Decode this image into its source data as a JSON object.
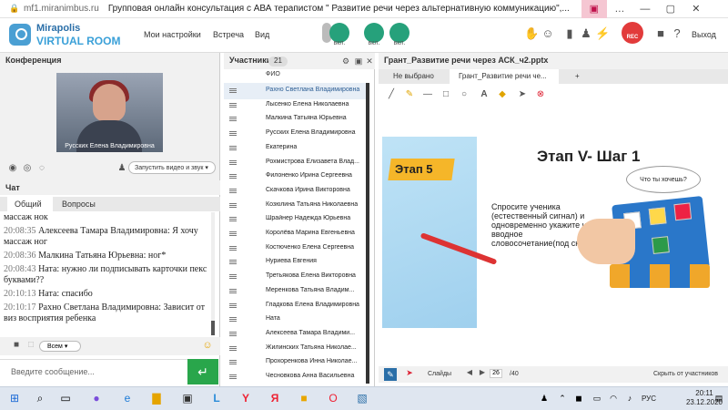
{
  "browser": {
    "url": "mf1.miranimbus.ru",
    "title": "Групповая онлайн консультация с АВА терапистом \" Развитие речи через альтернативную коммуникацию\",..."
  },
  "app": {
    "logo_line1": "Mirapolis",
    "logo_line2": "VIRTUAL ROOM",
    "menu": [
      "Мои настройки",
      "Встреча",
      "Вид"
    ],
    "controls": [
      "вкл.",
      "вкл.",
      "вкл."
    ],
    "rec_label": "REC",
    "exit_label": "Выход"
  },
  "conference": {
    "title": "Конференция",
    "speaker_name": "Русских Елена Владимировна",
    "start_video_button": "Запустить видео и звук"
  },
  "chat": {
    "title": "Чат",
    "tabs": [
      "Общий",
      "Вопросы"
    ],
    "messages": [
      {
        "time": "",
        "author": "",
        "text": "массаж нок"
      },
      {
        "time": "20:08:35",
        "author": "Алексеева Тамара Владимировна:",
        "text": "Я хочу массаж ног"
      },
      {
        "time": "20:08:36",
        "author": "Малкина Татьяна Юрьевна:",
        "text": "ног*"
      },
      {
        "time": "20:08:43",
        "author": "Ната:",
        "text": "нужно ли подписывать карточки пекс буквами??"
      },
      {
        "time": "20:10:13",
        "author": "Ната:",
        "text": "спасибо"
      },
      {
        "time": "20:10:17",
        "author": "Рахно Светлана Владимировна:",
        "text": "Зависит от виз восприятия ребенка"
      }
    ],
    "recipient_select": "Всем",
    "input_placeholder": "Введите сообщение..."
  },
  "participants": {
    "title": "Участники",
    "count": "21",
    "column_header": "ФИО",
    "list": [
      "Рахно Светлана Владимировна",
      "Лысенко Елена Николаевна",
      "Малкина Татьяна Юрьевна",
      "Русских Елена Владимировна",
      "Екатерина",
      "Рохмистрова Елизавета Влад...",
      "Филоненко Ирина Сергеевна",
      "Скачкова Ирина Викторовна",
      "Козюлина Татьяна Николаевна",
      "Шрайнер Надежда Юрьевна",
      "Королёва Марина Евгеньевна",
      "Костюченко Елена Сергеевна",
      "Нуриева Евгения",
      "Третьякова Елена Викторовна",
      "Меренкова Татьяна Владим...",
      "Гладкова Елена Владимировна",
      "Ната",
      "Алексеева Тамара Владими...",
      "Жилинских Татьяна Николае...",
      "Прохоренкова Инна Николае...",
      "Чесновкова Анна Васильевна"
    ]
  },
  "presentation": {
    "title": "Грант_Развитие речи через АСК_ч2.pptx",
    "tabs": [
      "Не выбрано",
      "Грант_Развитие речи че...",
      "+"
    ],
    "slide": {
      "stage_label": "Этап 5",
      "heading": "Этап V- Шаг 1",
      "bubble": "Что ты хочешь?",
      "text": "Спросите ученика (естественный сигнал) и одновременно укажите на вводное словосочетание(под сказка)"
    },
    "slides_label": "Слайды",
    "current_slide": "26",
    "total_slides": "/40",
    "hide_button": "Скрыть от участников"
  },
  "taskbar": {
    "language": "РУС",
    "time": "20:11",
    "date": "23.12.2020"
  }
}
